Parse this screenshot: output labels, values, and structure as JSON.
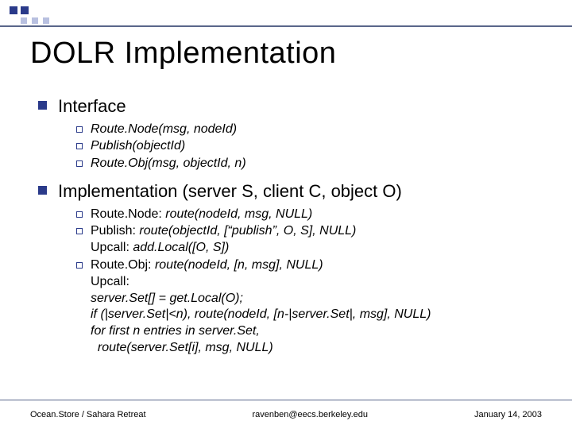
{
  "title": "DOLR Implementation",
  "sections": [
    {
      "heading": "Interface",
      "items": [
        {
          "text": "Route.Node(msg, nodeId)",
          "italic": true
        },
        {
          "text": "Publish(objectId)",
          "italic": true
        },
        {
          "text": "Route.Obj(msg, objectId, n)",
          "italic": true
        }
      ]
    },
    {
      "heading": "Implementation (server S, client C, object O)",
      "items": [
        {
          "text": "Route.Node: <i>route(nodeId, msg, NULL)</i>"
        },
        {
          "text": "Publish: <i>route(objectId, [“publish”, O, S], NULL)</i><br>Upcall: <i>add.Local([O, S])</i>"
        },
        {
          "text": "Route.Obj: <i>route(nodeId, [n, msg], NULL)</i><br>Upcall:<br><i>server.Set[] = get.Local(O);<br>if (|server.Set|&lt;n), route(nodeId, [n-|server.Set|, msg], NULL)<br>for first n entries in server.Set,<br>&nbsp;&nbsp;route(server.Set[i], msg, NULL)</i>"
        }
      ]
    }
  ],
  "footer": {
    "left": "Ocean.Store / Sahara Retreat",
    "center": "ravenben@eecs.berkeley.edu",
    "right": "January 14, 2003"
  }
}
